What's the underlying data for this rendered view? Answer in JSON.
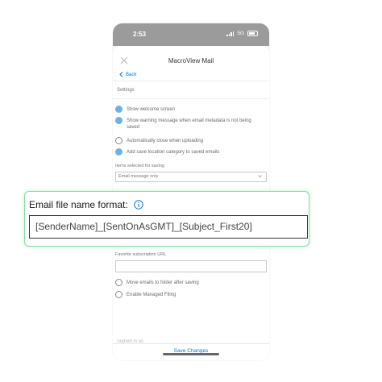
{
  "status_bar": {
    "time": "2:53",
    "network": "5G"
  },
  "header": {
    "title": "MacroView Mail",
    "back_label": "Back"
  },
  "settings": {
    "section_label": "Settings",
    "options": [
      {
        "label": "Show welcome screen",
        "checked": true
      },
      {
        "label": "Show warning message when email metadata is not being saved",
        "checked": true
      },
      {
        "label": "Automatically close when uploading",
        "checked": false
      },
      {
        "label": "Add save location category to saved emails",
        "checked": true
      }
    ],
    "items_selected_label": "Items selected for saving",
    "items_selected_value": "Email message only",
    "favorite_url_label": "Favorite subscription URL",
    "favorite_url_value": "",
    "bottom_options": [
      {
        "label": "Move emails to folder after saving",
        "checked": false
      },
      {
        "label": "Enable Managed Filing",
        "checked": false
      }
    ],
    "partial_label": "Signed in as"
  },
  "footer": {
    "save_label": "Save Changes"
  },
  "callout": {
    "label": "Email file name format:",
    "value": "[SenderName]_[SentOnAsGMT]_[Subject_First20]"
  },
  "colors": {
    "accent": "#0078d4",
    "checkbox_on": "#6cb2e8",
    "callout_border": "#82de9f"
  }
}
